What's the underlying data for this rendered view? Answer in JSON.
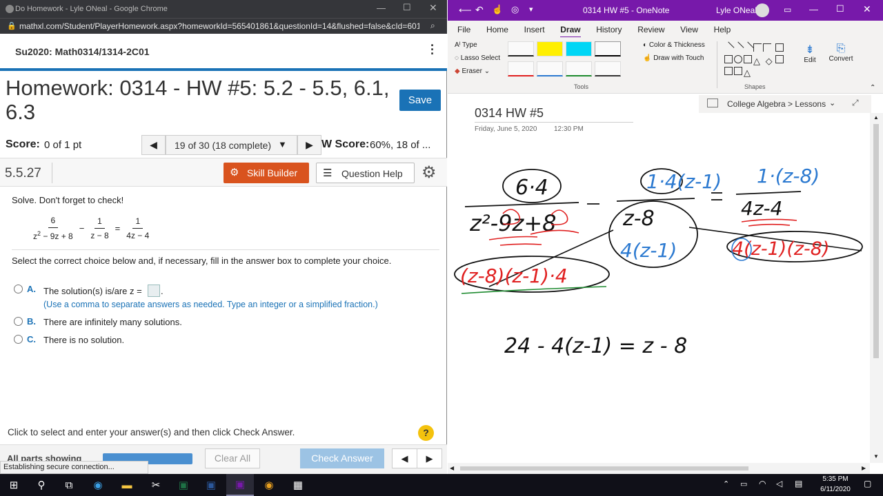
{
  "chrome": {
    "title": "Do Homework - Lyle ONeal - Google Chrome",
    "url": "mathxl.com/Student/PlayerHomework.aspx?homeworkId=565401861&questionId=14&flushed=false&cId=601..."
  },
  "course": "Su2020: Math0314/1314-2C01",
  "homework": {
    "title": "Homework: 0314 - HW #5: 5.2 - 5.5, 6.1, 6.3",
    "save_label": "Save",
    "score_label": "Score:",
    "score_value": "0 of 1 pt",
    "nav_progress": "19 of 30 (18 complete)",
    "hw_score_label": "W Score:",
    "hw_score_value": "60%, 18 of ..."
  },
  "question": {
    "number": "5.5.27",
    "skill_builder": "Skill Builder",
    "question_help": "Question Help",
    "instruction": "Solve. Don't forget to check!",
    "eq": {
      "n1": "6",
      "d1a": "z",
      "d1sup": "2",
      "d1b": " − 9z + 8",
      "minus": "−",
      "n2": "1",
      "d2": "z − 8",
      "equals": "=",
      "n3": "1",
      "d3": "4z − 4"
    },
    "select_text": "Select the correct choice below and, if necessary, fill in the answer box to complete your choice.",
    "choices": [
      {
        "letter": "A.",
        "text": "The solution(s) is/are z =",
        "hint": "(Use a comma to separate answers as needed. Type an integer or a simplified fraction.)"
      },
      {
        "letter": "B.",
        "text": "There are infinitely many solutions."
      },
      {
        "letter": "C.",
        "text": "There is no solution."
      }
    ],
    "footer_text": "Click to select and enter your answer(s) and then click Check Answer.",
    "all_parts": "All parts showing",
    "clear_all": "Clear All",
    "check_answer": "Check Answer",
    "status": "Establishing secure connection..."
  },
  "onenote": {
    "title": "0314 HW #5 - OneNote",
    "user": "Lyle ONeal",
    "tabs": [
      "File",
      "Home",
      "Insert",
      "Draw",
      "History",
      "Review",
      "View",
      "Help"
    ],
    "active_tab": "Draw",
    "tools": {
      "type": "Type",
      "lasso": "Lasso Select",
      "eraser": "Eraser",
      "color_thickness": "Color & Thickness",
      "draw_touch": "Draw with Touch",
      "group_tools": "Tools",
      "group_shapes": "Shapes",
      "edit": "Edit",
      "convert": "Convert"
    },
    "page_title": "0314 HW #5",
    "date": "Friday, June 5, 2020",
    "time": "12:30 PM",
    "notebook": "College Algebra > Lessons"
  },
  "ink": {
    "t1": "6·4",
    "t2": "1·4(z-1)",
    "t3": "1·(z-8)",
    "d1": "z²-9z+8",
    "d2": "z-8",
    "d3": "4z-4",
    "f1": "(z-8)(z-1)·4",
    "f2": "4(z-1)",
    "f3": "4(z-1)(z-8)",
    "eq": "24 - 4(z-1) = z - 8"
  },
  "taskbar": {
    "time": "5:35 PM",
    "date": "6/11/2020"
  },
  "colors": {
    "mathxl_blue": "#1a72b6",
    "skill_orange": "#d9531e",
    "onenote_purple": "#7719aa",
    "chrome_dark": "#35363a",
    "taskbar": "#101018"
  }
}
